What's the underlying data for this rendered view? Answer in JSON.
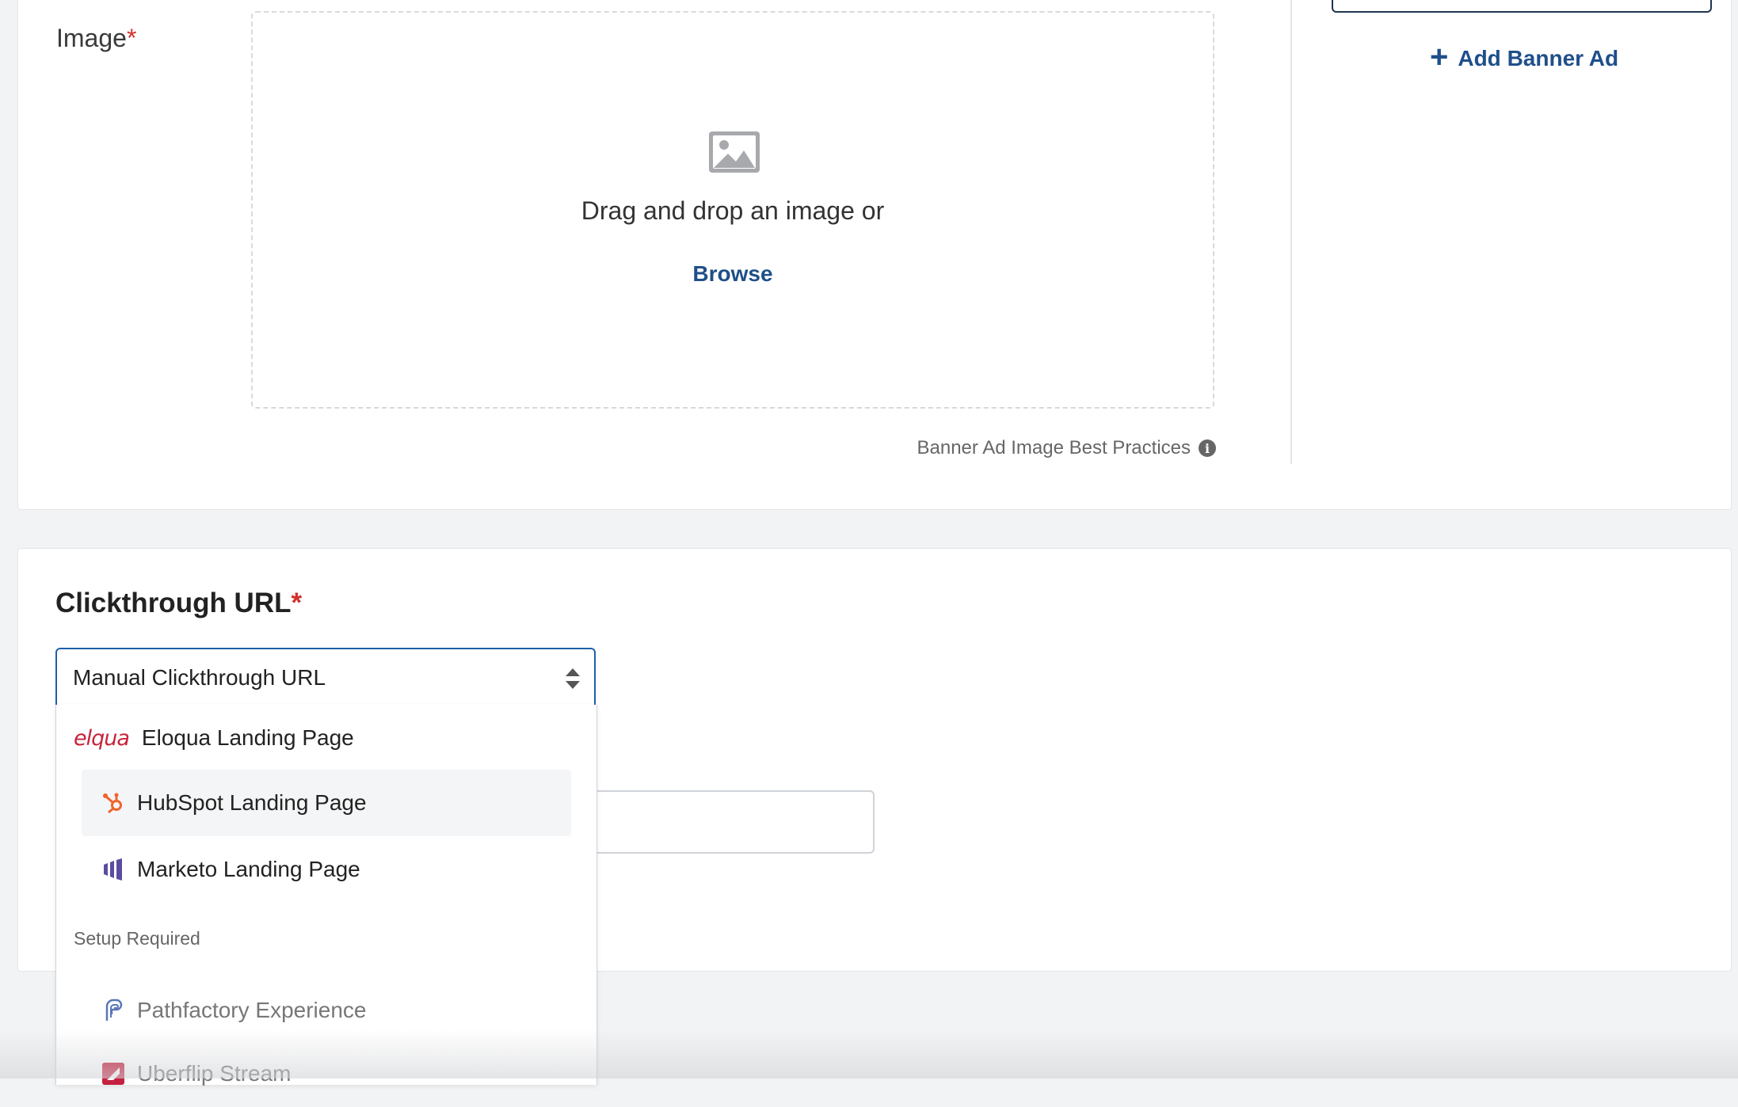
{
  "image_section": {
    "label": "Image",
    "required_mark": "*",
    "drop_text": "Drag and drop an image or",
    "browse_label": "Browse",
    "best_practices_label": "Banner Ad Image Best Practices",
    "info_icon": "info-circle-icon"
  },
  "sidebar": {
    "add_banner_label": "Add Banner Ad",
    "add_icon": "plus-icon"
  },
  "clickthrough": {
    "title": "Clickthrough URL",
    "required_mark": "*",
    "selected_value": "Manual Clickthrough URL",
    "options": [
      {
        "label": "Eloqua Landing Page",
        "logo_text": "elqua",
        "icon": "eloqua-logo"
      },
      {
        "label": "HubSpot Landing Page",
        "icon": "hubspot-icon",
        "hovered": true
      },
      {
        "label": "Marketo Landing Page",
        "icon": "marketo-icon"
      }
    ],
    "setup_group_label": "Setup Required",
    "setup_options": [
      {
        "label": "Pathfactory Experience",
        "icon": "pathfactory-icon"
      },
      {
        "label": "Uberflip Stream",
        "icon": "uberflip-icon"
      }
    ]
  },
  "colors": {
    "accent": "#1f4f8a",
    "required": "#d0312d",
    "hubspot": "#f0642c",
    "marketo": "#5c4c9f",
    "eloqua": "#c8233b",
    "uberflip": "#c4203f"
  }
}
